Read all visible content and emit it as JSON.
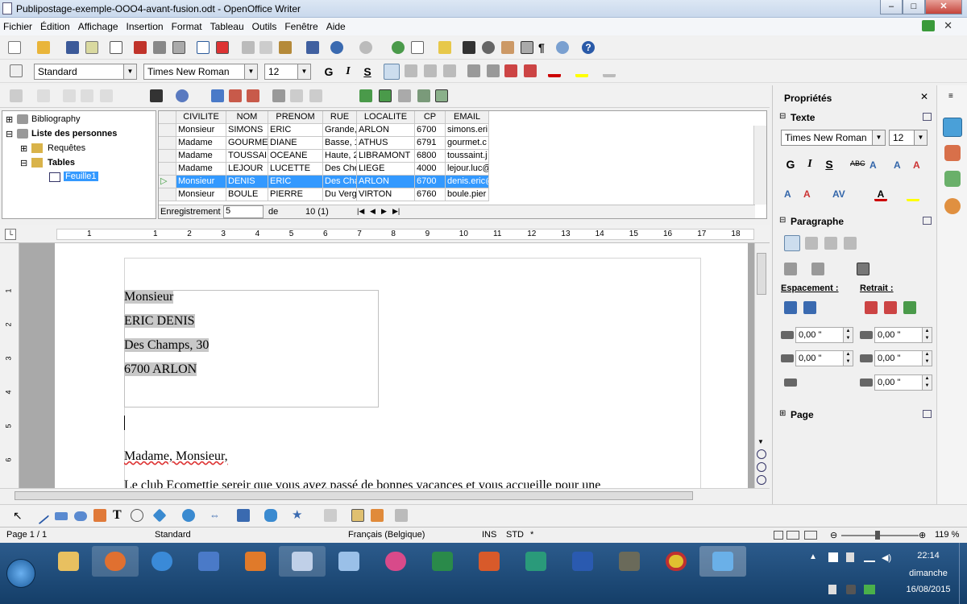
{
  "window": {
    "title": "Publipostage-exemple-OOO4-avant-fusion.odt - OpenOffice Writer",
    "min": "–",
    "max": "□",
    "close": "✕"
  },
  "menu": [
    "Fichier",
    "Édition",
    "Affichage",
    "Insertion",
    "Format",
    "Tableau",
    "Outils",
    "Fenêtre",
    "Aide"
  ],
  "format_bar": {
    "style": "Standard",
    "font": "Times New Roman",
    "size": "12",
    "bold": "G",
    "italic": "I",
    "strike": "S"
  },
  "tree": {
    "items": [
      {
        "label": "Bibliography",
        "bold": false
      },
      {
        "label": "Liste des personnes",
        "bold": true
      },
      {
        "label": "Requêtes",
        "bold": false
      },
      {
        "label": "Tables",
        "bold": true
      },
      {
        "label": "Feuille1",
        "bold": false
      }
    ]
  },
  "grid": {
    "columns": [
      "CIVILITE",
      "NOM",
      "PRENOM",
      "RUE",
      "LOCALITE",
      "CP",
      "EMAIL"
    ],
    "rows": [
      [
        "Monsieur",
        "SIMONS",
        "ERIC",
        "Grande, 1",
        "ARLON",
        "6700",
        "simons.eri"
      ],
      [
        "Madame",
        "GOURME",
        "DIANE",
        "Basse, 1",
        "ATHUS",
        "6791",
        "gourmet.c"
      ],
      [
        "Madame",
        "TOUSSAII",
        "OCEANE",
        "Haute, 2",
        "LIBRAMONT",
        "6800",
        "toussaint.j"
      ],
      [
        "Madame",
        "LEJOUR",
        "LUCETTE",
        "Des Ché",
        "LIEGE",
        "4000",
        "lejour.luc@"
      ],
      [
        "Monsieur",
        "DENIS",
        "ERIC",
        "Des Cha",
        "ARLON",
        "6700",
        "denis.eric@"
      ],
      [
        "Monsieur",
        "BOULE",
        "PIERRE",
        "Du Verg",
        "VIRTON",
        "6760",
        "boule.pier"
      ]
    ],
    "selected_row": 4,
    "record_label": "Enregistrement",
    "record_value": "5",
    "of_label": "de",
    "count": "10 (1)"
  },
  "ruler": {
    "ticks": [
      "1",
      "1",
      "2",
      "3",
      "4",
      "5",
      "6",
      "7",
      "8",
      "9",
      "10",
      "11",
      "12",
      "13",
      "14",
      "15",
      "16",
      "17",
      "18"
    ],
    "vticks": [
      "1",
      "2",
      "3",
      "4",
      "5",
      "6"
    ]
  },
  "document": {
    "address": [
      "Monsieur",
      "ERIC DENIS",
      "Des Champs, 30",
      "6700 ARLON"
    ],
    "greeting": "Madame, Monsieur,",
    "body_cut": "Le club Ecomettie sereir que vous avez passé de bonnes vacances et vous accueille pour une"
  },
  "sidebar": {
    "title": "Propriétés",
    "text_section": "Texte",
    "font": "Times New Roman",
    "size": "12",
    "para_section": "Paragraphe",
    "spacing_label": "Espacement :",
    "indent_label": "Retrait :",
    "spin_values": [
      "0,00 \"",
      "0,00 \"",
      "0,00 \"",
      "0,00 \"",
      "0,00 \""
    ],
    "page_section": "Page"
  },
  "status": {
    "page": "Page 1 / 1",
    "style": "Standard",
    "lang": "Français (Belgique)",
    "ins": "INS",
    "std": "STD",
    "star": "*",
    "zoom": "119 %"
  },
  "taskbar": {
    "time": "22:14",
    "day": "dimanche",
    "date": "16/08/2015"
  },
  "colors": {
    "selection": "#3399ff",
    "field_shade": "#c8c8c8",
    "taskbar": "#1e4c7a"
  }
}
